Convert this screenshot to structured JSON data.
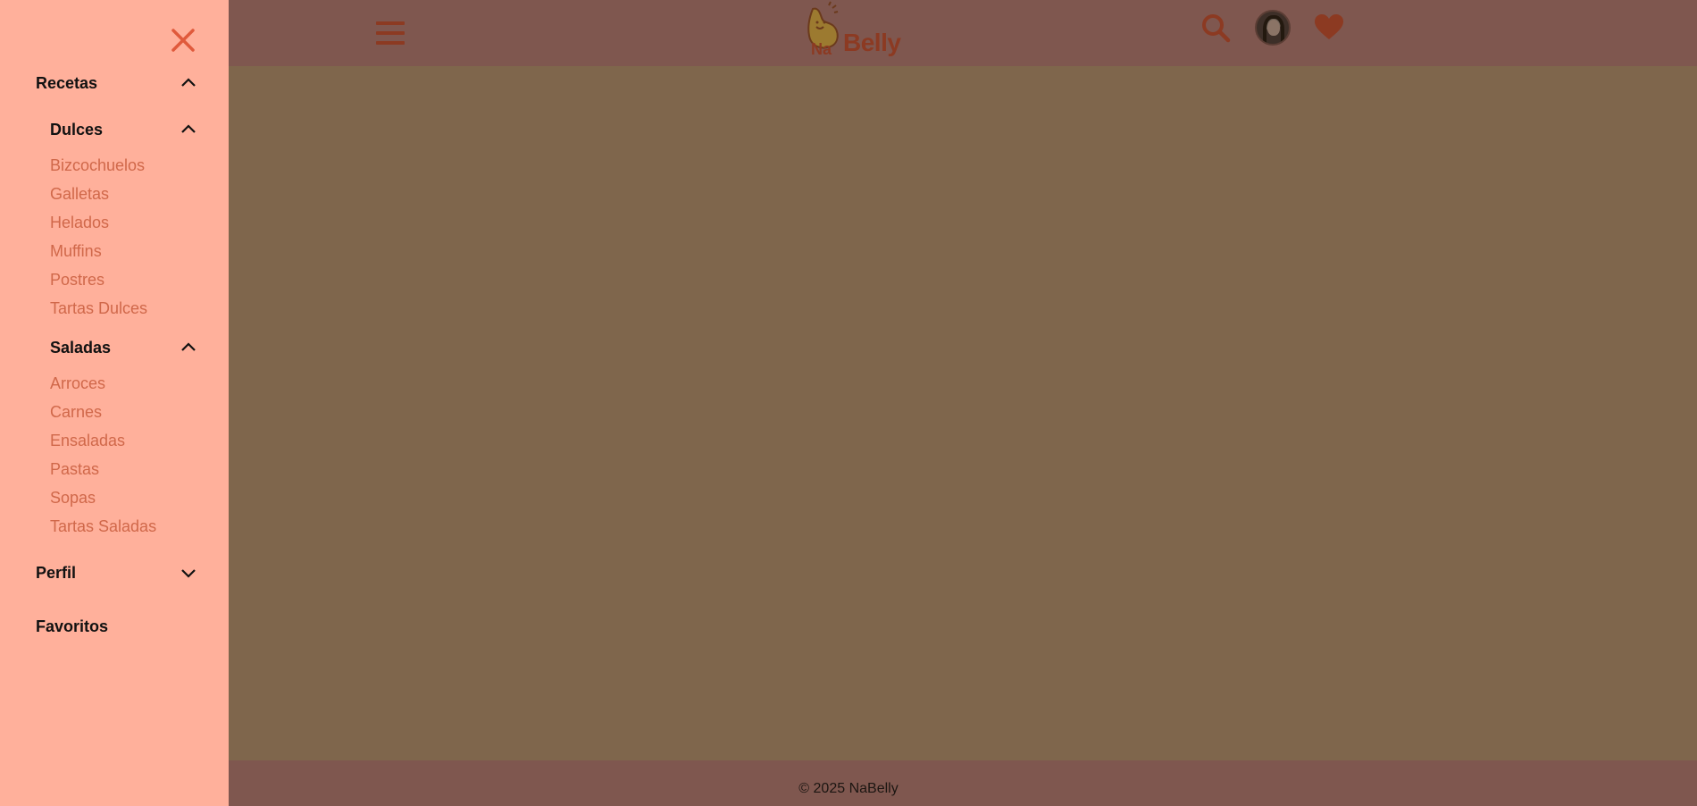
{
  "header": {
    "brand_prefix": "Na",
    "brand_name": "Belly"
  },
  "footer": {
    "text": "© 2025 NaBelly"
  },
  "drawer": {
    "sections": [
      {
        "label": "Recetas",
        "expanded": true
      },
      {
        "label": "Perfil",
        "expanded": false
      },
      {
        "label": "Favoritos"
      }
    ],
    "dulces": {
      "label": "Dulces",
      "items": [
        "Bizcochuelos",
        "Galletas",
        "Helados",
        "Muffins",
        "Postres",
        "Tartas Dulces"
      ]
    },
    "saladas": {
      "label": "Saladas",
      "items": [
        "Arroces",
        "Carnes",
        "Ensaladas",
        "Pastas",
        "Sopas",
        "Tartas Saladas"
      ]
    }
  },
  "colors": {
    "drawer_bg": "#ffb09b",
    "link": "#d0684a",
    "brand": "#8c3a22",
    "header_dimmed": "#7f574f",
    "main_dimmed": "#7f664c"
  },
  "icons": {
    "menu": "hamburger-icon",
    "search": "search-icon",
    "favorites": "heart-icon",
    "close": "close-icon",
    "expand": "chevron-up-icon",
    "collapse": "chevron-down-icon"
  }
}
